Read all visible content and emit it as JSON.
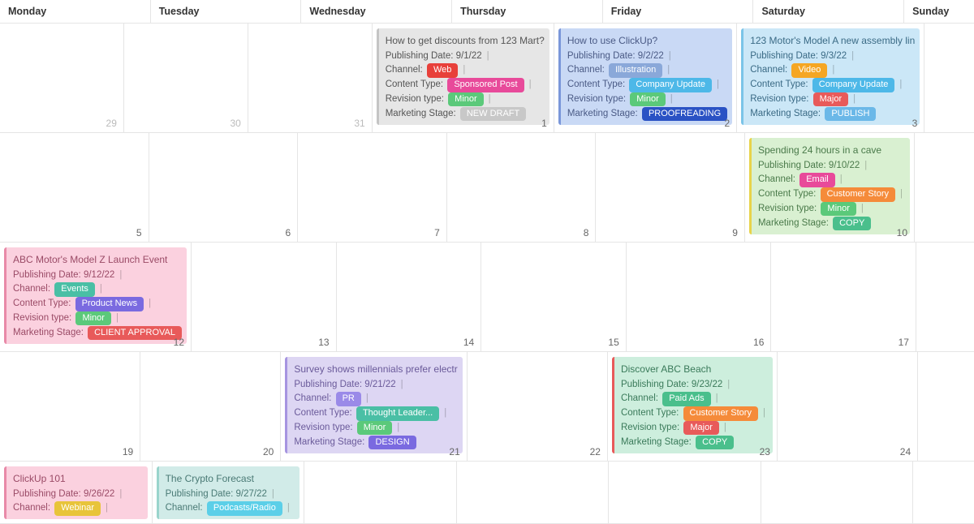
{
  "days": [
    "Monday",
    "Tuesday",
    "Wednesday",
    "Thursday",
    "Friday",
    "Saturday",
    "Sunday"
  ],
  "labels": {
    "pub": "Publishing Date:",
    "channel": "Channel:",
    "ctype": "Content Type:",
    "rev": "Revision type:",
    "stage": "Marketing Stage:"
  },
  "weeks": [
    {
      "nums": [
        "29",
        "30",
        "31",
        "1",
        "2",
        "3",
        ""
      ],
      "other": [
        true,
        true,
        true,
        false,
        false,
        false,
        false
      ]
    },
    {
      "nums": [
        "5",
        "6",
        "7",
        "8",
        "9",
        "10",
        ""
      ],
      "other": [
        false,
        false,
        false,
        false,
        false,
        false,
        false
      ]
    },
    {
      "nums": [
        "12",
        "13",
        "14",
        "15",
        "16",
        "17",
        ""
      ],
      "other": [
        false,
        false,
        false,
        false,
        false,
        false,
        false
      ]
    },
    {
      "nums": [
        "19",
        "20",
        "21",
        "22",
        "23",
        "24",
        ""
      ],
      "other": [
        false,
        false,
        false,
        false,
        false,
        false,
        false
      ]
    },
    {
      "nums": [
        "",
        "",
        "",
        "",
        "",
        "",
        ""
      ],
      "other": [
        false,
        false,
        false,
        false,
        false,
        false,
        false
      ]
    }
  ],
  "events": {
    "e1": {
      "title": "How to get discounts from 123 Mart?",
      "pub": "9/1/22",
      "channel": "Web",
      "ctype": "Sponsored Post",
      "rev": "Minor",
      "stage": "NEW DRAFT"
    },
    "e2": {
      "title": "How to use ClickUp?",
      "pub": "9/2/22",
      "channel": "Illustration",
      "ctype": "Company Update",
      "rev": "Minor",
      "stage": "PROOFREADING"
    },
    "e3": {
      "title": "123 Motor's Model A new assembly lin",
      "pub": "9/3/22",
      "channel": "Video",
      "ctype": "Company Update",
      "rev": "Major",
      "stage": "PUBLISH"
    },
    "e4": {
      "title": "Spending 24 hours in a cave",
      "pub": "9/10/22",
      "channel": "Email",
      "ctype": "Customer Story",
      "rev": "Minor",
      "stage": "COPY"
    },
    "e5": {
      "title": "ABC Motor's Model Z Launch Event",
      "pub": "9/12/22",
      "channel": "Events",
      "ctype": "Product News",
      "rev": "Minor",
      "stage": "CLIENT APPROVAL"
    },
    "e6": {
      "title": "Survey shows millennials prefer electr",
      "pub": "9/21/22",
      "channel": "PR",
      "ctype": "Thought Leader...",
      "rev": "Minor",
      "stage": "DESIGN"
    },
    "e7": {
      "title": "Discover ABC Beach",
      "pub": "9/23/22",
      "channel": "Paid Ads",
      "ctype": "Customer Story",
      "rev": "Major",
      "stage": "COPY"
    },
    "e8": {
      "title": "ClickUp 101",
      "pub": "9/26/22",
      "channel": "Webinar"
    },
    "e9": {
      "title": "The Crypto Forecast",
      "pub": "9/27/22",
      "channel": "Podcasts/Radio"
    }
  }
}
